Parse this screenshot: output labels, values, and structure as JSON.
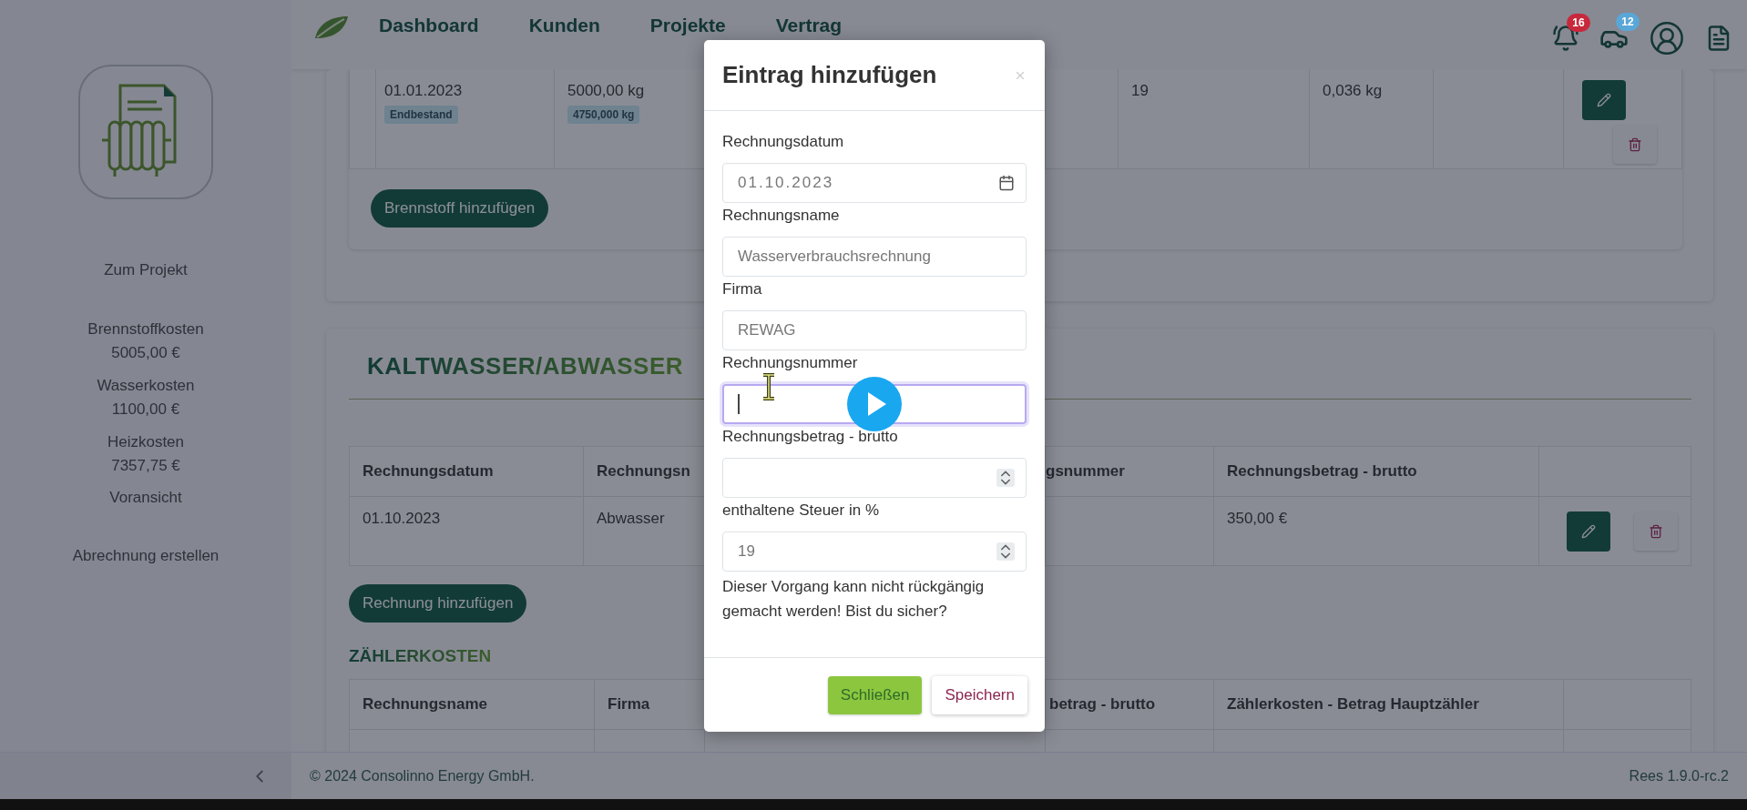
{
  "nav": {
    "items": [
      {
        "label": "Dashboard"
      },
      {
        "label": "Kunden"
      },
      {
        "label": "Projekte"
      },
      {
        "label": "Vertrag"
      }
    ],
    "badges": [
      {
        "count": "16",
        "color": "#c8283c"
      },
      {
        "count": "12",
        "color": "#5aa6d6"
      }
    ]
  },
  "sidebar": {
    "project_link": "Zum Projekt",
    "costs": [
      {
        "label": "Brennstoffkosten",
        "value": "5005,00 €"
      },
      {
        "label": "Wasserkosten",
        "value": "1100,00 €"
      },
      {
        "label": "Heizkosten",
        "value": "7357,75 €"
      }
    ],
    "preview_link": "Voransicht",
    "create_link": "Abrechnung erstellen"
  },
  "fuel": {
    "rows": [
      {
        "date": "01.01.2023",
        "date_tag": "Endbestand",
        "amount": "5000,00 kg",
        "amount_tag": "4750,000 kg",
        "column_5": "19",
        "column_6": "0,036 kg"
      }
    ],
    "add_button": "Brennstoff hinzufügen"
  },
  "water": {
    "title": "KALTWASSER/ABWASSER",
    "columns": [
      "Rechnungsdatum",
      "Rechnungsn",
      "gsnummer",
      "Rechnungsbetrag - brutto"
    ],
    "rows": [
      {
        "date": "01.10.2023",
        "name": "Abwasser",
        "amount": "350,00 €"
      }
    ],
    "add_button": "Rechnung hinzufügen"
  },
  "meter": {
    "title": "ZÄHLERKOSTEN",
    "columns": [
      "Rechnungsname",
      "Firma",
      "betrag - brutto",
      "Zählerkosten - Betrag Hauptzähler"
    ]
  },
  "modal": {
    "title": "Eintrag hinzufügen",
    "fields": [
      {
        "kind": "date",
        "label": "Rechnungsdatum",
        "value": "01.10.2023",
        "focused": false
      },
      {
        "kind": "text",
        "label": "Rechnungsname",
        "value": "Wasserverbrauchsrechnung",
        "focused": false
      },
      {
        "kind": "text",
        "label": "Firma",
        "value": "REWAG",
        "focused": false
      },
      {
        "kind": "text",
        "label": "Rechnungsnummer",
        "focused": true
      },
      {
        "kind": "number",
        "label": "Rechnungsbetrag - brutto",
        "focused": false
      },
      {
        "kind": "number",
        "label": "enthaltene Steuer in %",
        "value": "19",
        "focused": false
      }
    ],
    "warning": "Dieser Vorgang kann nicht rückgängig gemacht werden! Bist du sicher?",
    "close_button": "Schließen",
    "save_button": "Speichern"
  },
  "footer": {
    "copyright": "© 2024 Consolinno Energy GmbH.",
    "version": "Rees 1.9.0-rc.2"
  }
}
